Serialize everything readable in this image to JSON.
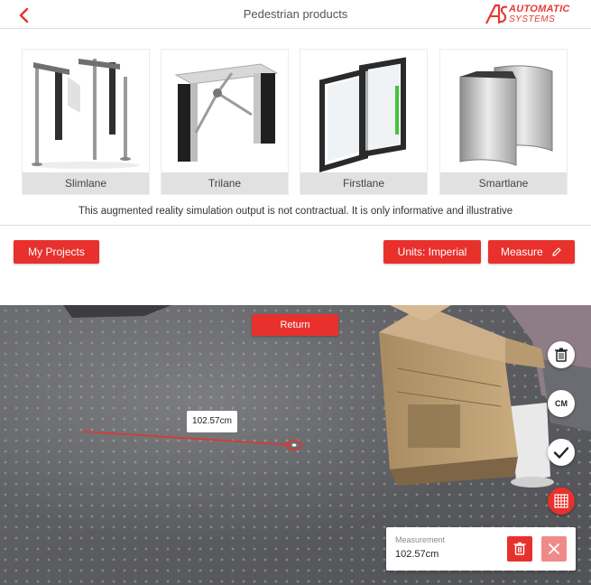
{
  "header": {
    "title": "Pedestrian products",
    "logo_line1": "AUTOMATIC",
    "logo_line2": "SYSTEMS"
  },
  "products": [
    {
      "label": "Slimlane"
    },
    {
      "label": "Trilane"
    },
    {
      "label": "Firstlane"
    },
    {
      "label": "Smartlane"
    }
  ],
  "disclaimer": "This augmented reality simulation output is not contractual. It is only informative and illustrative",
  "actions": {
    "my_projects": "My Projects",
    "units": "Units: Imperial",
    "measure": "Measure"
  },
  "ar": {
    "return_label": "Return",
    "unit_toggle": "CM",
    "measurement_label": "102.57cm",
    "panel_title": "Measurement",
    "panel_value": "102.57cm"
  },
  "colors": {
    "accent": "#e8312d",
    "floor": "#5d5e62",
    "card_label_bg": "#e1e1e1"
  },
  "icons": [
    "back-chevron-icon",
    "pencil-icon",
    "trash-icon",
    "check-icon",
    "grid-icon",
    "close-icon"
  ]
}
